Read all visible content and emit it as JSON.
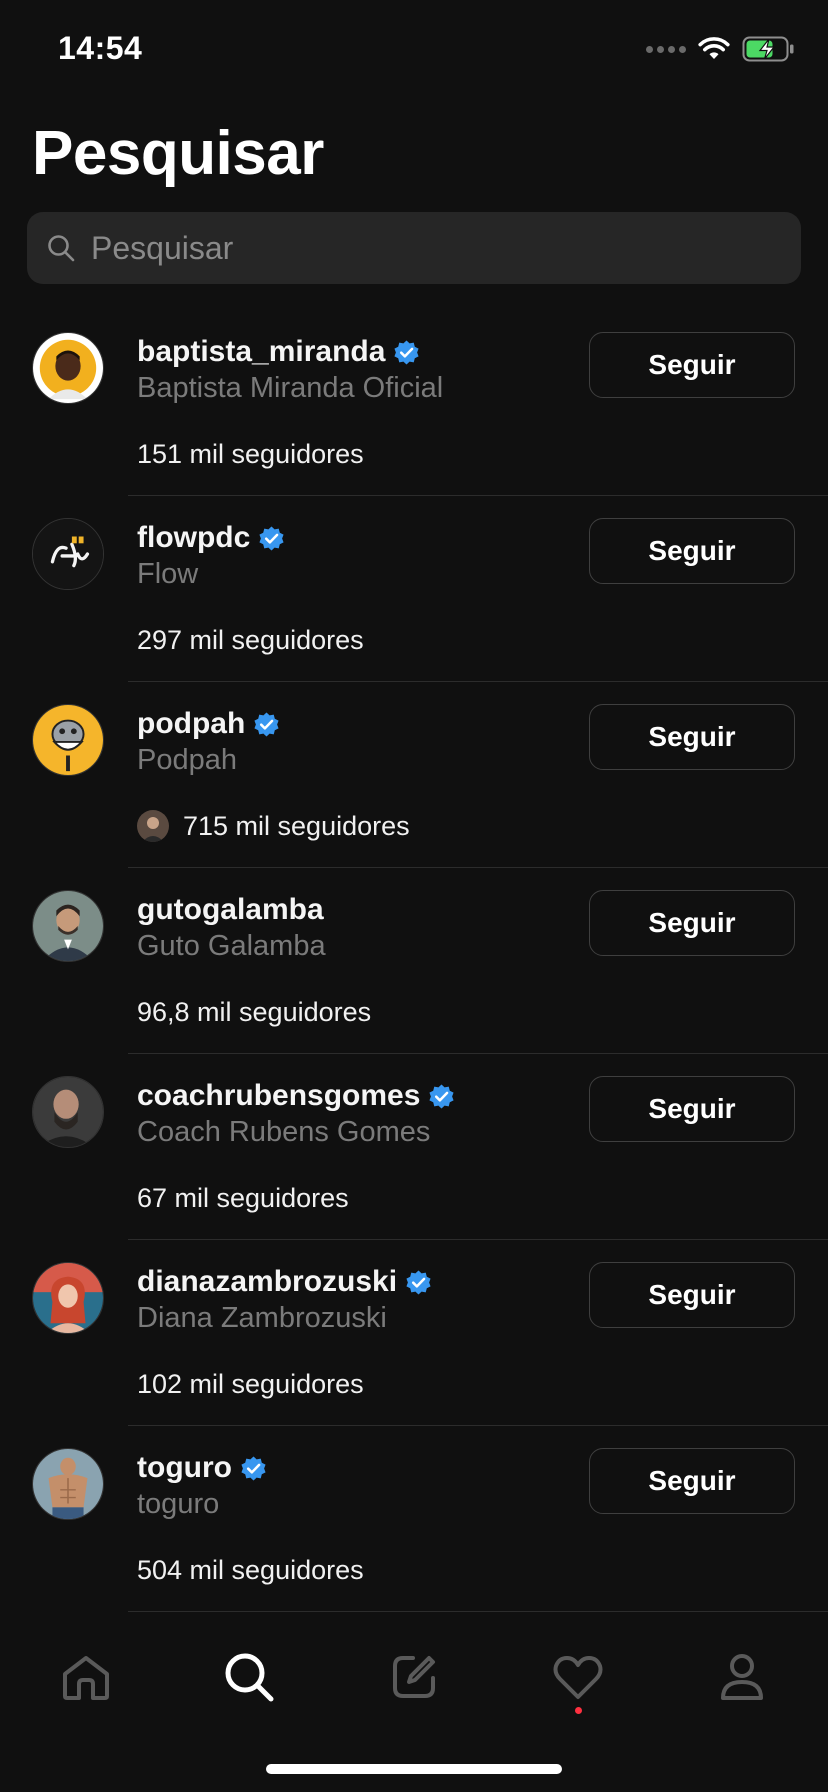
{
  "status_bar": {
    "time": "14:54"
  },
  "title": "Pesquisar",
  "search": {
    "placeholder": "Pesquisar",
    "value": ""
  },
  "colors": {
    "background": "#101010",
    "verified_badge": "#3897f0",
    "notification_dot": "#ff3040"
  },
  "results": [
    {
      "username": "baptista_miranda",
      "verified": true,
      "full_name": "Baptista Miranda Oficial",
      "followers": "151 mil seguidores",
      "follow_label": "Seguir"
    },
    {
      "username": "flowpdc",
      "verified": true,
      "full_name": "Flow",
      "followers": "297 mil seguidores",
      "follow_label": "Seguir"
    },
    {
      "username": "podpah",
      "verified": true,
      "full_name": "Podpah",
      "followers": "715 mil seguidores",
      "follow_label": "Seguir"
    },
    {
      "username": "gutogalamba",
      "verified": false,
      "full_name": "Guto Galamba",
      "followers": "96,8 mil seguidores",
      "follow_label": "Seguir"
    },
    {
      "username": "coachrubensgomes",
      "verified": true,
      "full_name": "Coach Rubens Gomes",
      "followers": "67 mil seguidores",
      "follow_label": "Seguir"
    },
    {
      "username": "dianazambrozuski",
      "verified": true,
      "full_name": "Diana Zambrozuski",
      "followers": "102 mil seguidores",
      "follow_label": "Seguir"
    },
    {
      "username": "toguro",
      "verified": true,
      "full_name": "toguro",
      "followers": "504 mil seguidores",
      "follow_label": "Seguir"
    }
  ],
  "tab_bar": {
    "tabs": [
      {
        "icon": "home-icon",
        "active": false
      },
      {
        "icon": "search-icon",
        "active": true
      },
      {
        "icon": "compose-icon",
        "active": false
      },
      {
        "icon": "heart-icon",
        "active": false,
        "notification": true
      },
      {
        "icon": "profile-icon",
        "active": false
      }
    ]
  }
}
